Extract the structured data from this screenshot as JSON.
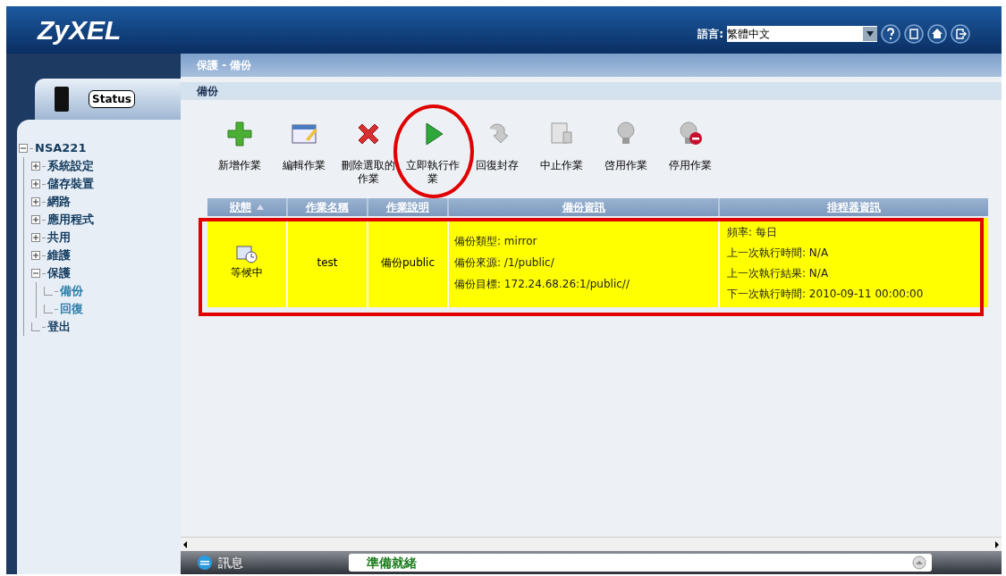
{
  "header": {
    "logo": "ZyXEL",
    "language_label": "語言:",
    "language_value": "繁體中文"
  },
  "sidebar": {
    "tab": "Status",
    "tree": [
      {
        "label": "NSA221",
        "expanded": true,
        "children": [
          {
            "label": "系統設定",
            "expanded": false
          },
          {
            "label": "儲存裝置",
            "expanded": false
          },
          {
            "label": "網路",
            "expanded": false
          },
          {
            "label": "應用程式",
            "expanded": false
          },
          {
            "label": "共用",
            "expanded": false
          },
          {
            "label": "維護",
            "expanded": false
          },
          {
            "label": "保護",
            "expanded": true,
            "children": [
              {
                "label": "備份"
              },
              {
                "label": "回復"
              }
            ]
          },
          {
            "label": "登出"
          }
        ]
      }
    ]
  },
  "breadcrumb": "保護 - 備份",
  "section_title": "備份",
  "toolbar": [
    {
      "label": "新增作業"
    },
    {
      "label": "編輯作業"
    },
    {
      "label": "刪除選取的作業"
    },
    {
      "label": "立即執行作業"
    },
    {
      "label": "回復封存"
    },
    {
      "label": "中止作業"
    },
    {
      "label": "啓用作業"
    },
    {
      "label": "停用作業"
    }
  ],
  "table": {
    "columns": [
      "狀態",
      "作業名稱",
      "作業說明",
      "備份資訊",
      "排程器資訊"
    ],
    "rows": [
      {
        "status": "等候中",
        "name": "test",
        "description": "備份public",
        "backup_info": [
          "備份類型: mirror",
          "備份來源: /1/public/",
          "備份目標: 172.24.68.26:1/public//"
        ],
        "scheduler_info": [
          "頻率: 每日",
          "上一次執行時間: N/A",
          "上一次執行結果: N/A",
          "下一次執行時間: 2010-09-11 00:00:00"
        ]
      }
    ]
  },
  "status_bar": {
    "label": "訊息",
    "message": "準備就緒"
  }
}
